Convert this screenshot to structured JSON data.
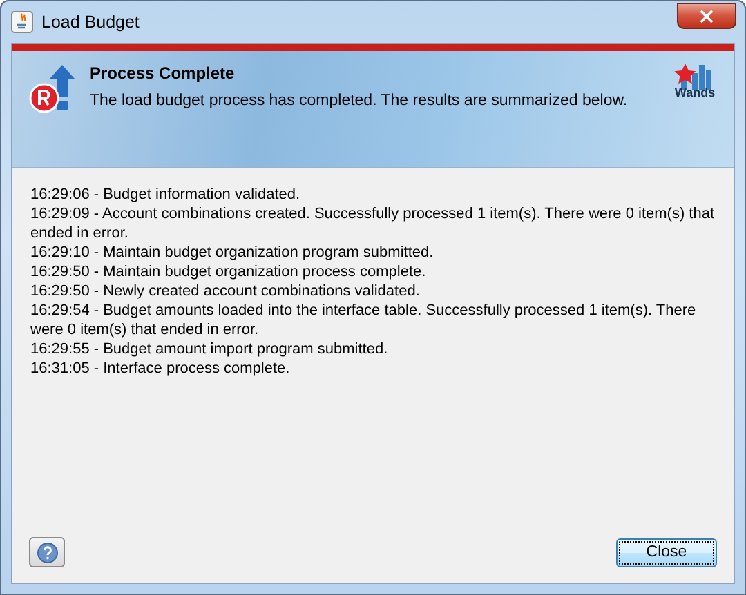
{
  "window": {
    "title": "Load Budget",
    "close": "×"
  },
  "header": {
    "title": "Process Complete",
    "message": "The load budget process has completed. The results are summarized below.",
    "logo_text": "Wands"
  },
  "log": [
    "16:29:06 - Budget information validated.",
    "16:29:09 - Account combinations created. Successfully processed 1 item(s). There were 0 item(s) that ended in error.",
    "16:29:10 - Maintain budget organization program submitted.",
    "16:29:50 - Maintain budget organization process complete.",
    "16:29:50 - Newly created account combinations validated.",
    "16:29:54 - Budget amounts loaded into the interface table. Successfully processed 1 item(s). There were 0 item(s) that ended in error.",
    "16:29:55 - Budget amount import program submitted.",
    "16:31:05 - Interface process complete."
  ],
  "buttons": {
    "close": "Close"
  }
}
